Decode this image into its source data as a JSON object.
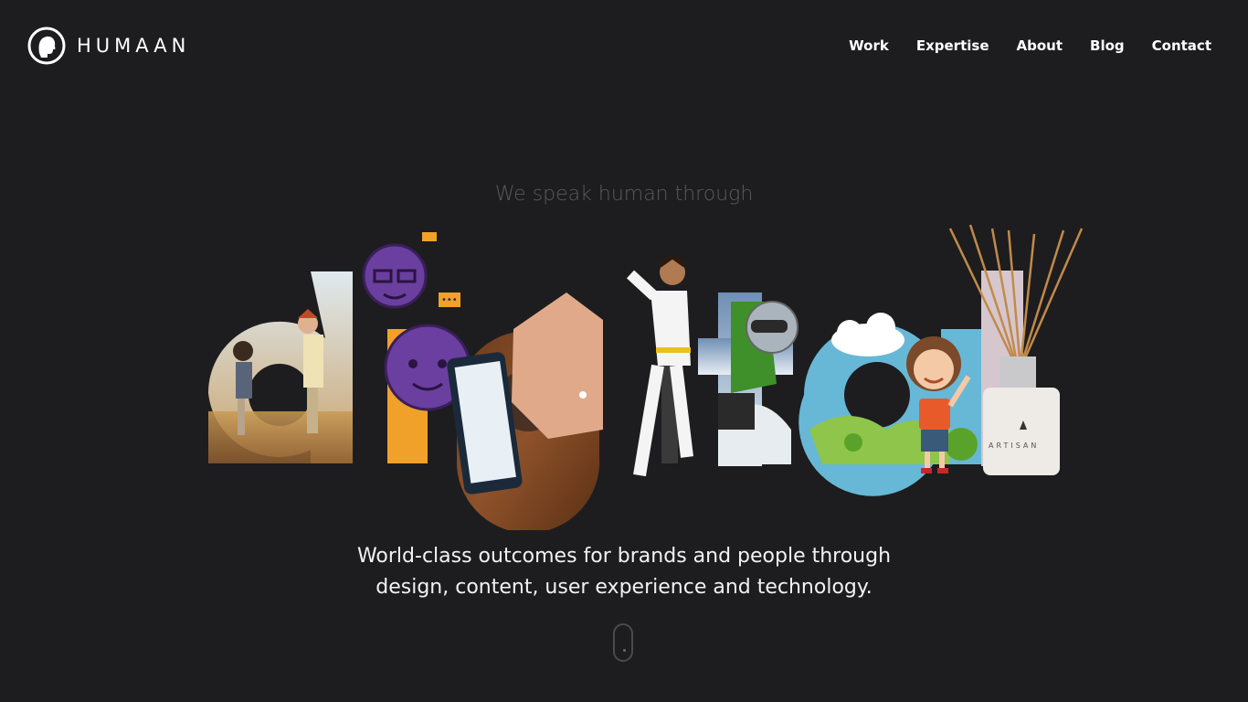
{
  "brand": {
    "name": "HUMAAN",
    "logo_icon": "head-silhouette-icon"
  },
  "nav": {
    "items": [
      "Work",
      "Expertise",
      "About",
      "Blog",
      "Contact"
    ]
  },
  "hero": {
    "tagline": "We speak human through",
    "word": "digital",
    "product_label": "ARTISAN"
  },
  "subline": {
    "line1": "World-class outcomes for brands and people through",
    "line2": "design, content, user experience and technology."
  },
  "scroll_indicator": "mouse-scroll-icon",
  "colors": {
    "background": "#1d1d1f",
    "tagline": "#5a5a5c",
    "text": "#ffffff"
  }
}
